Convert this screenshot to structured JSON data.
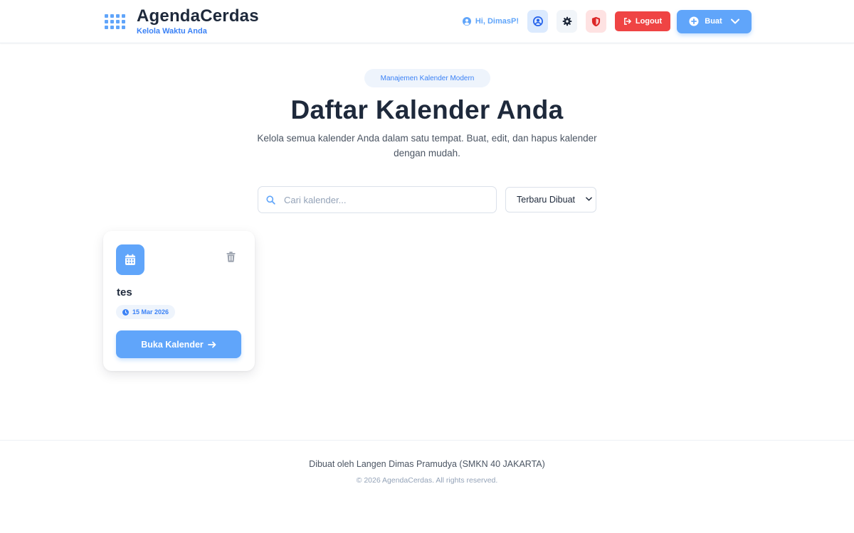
{
  "header": {
    "brand_title": "AgendaCerdas",
    "brand_subtitle": "Kelola Waktu Anda",
    "greeting": "Hi, DimasP!",
    "logout_label": "Logout",
    "create_label": "Buat"
  },
  "hero": {
    "badge": "Manajemen Kalender Modern",
    "title": "Daftar Kalender Anda",
    "description": "Kelola semua kalender Anda dalam satu tempat. Buat, edit, dan hapus kalender dengan mudah."
  },
  "toolbar": {
    "search_placeholder": "Cari kalender...",
    "search_value": "",
    "sort_selected": "Terbaru Dibuat"
  },
  "calendars": [
    {
      "name": "tes",
      "date": "15 Mar 2026",
      "open_label": "Buka Kalender"
    }
  ],
  "footer": {
    "credit": "Dibuat oleh Langen Dimas Pramudya (SMKN 40 JAKARTA)",
    "copyright": "© 2026 AgendaCerdas. All rights reserved."
  },
  "colors": {
    "primary": "#60a5fa",
    "accent": "#3b82f6",
    "danger": "#ef4444",
    "text": "#1e293b"
  },
  "icons": {
    "brand": "grid-logo-icon",
    "greeting": "user-circle-icon",
    "profile": "user-circle-icon",
    "settings": "gear-icon",
    "admin": "shield-icon",
    "logout": "logout-icon",
    "create": "plus-circle-icon",
    "search": "search-icon",
    "calendar": "calendar-icon",
    "delete": "trash-icon",
    "date": "clock-icon",
    "open": "arrow-right-icon"
  }
}
